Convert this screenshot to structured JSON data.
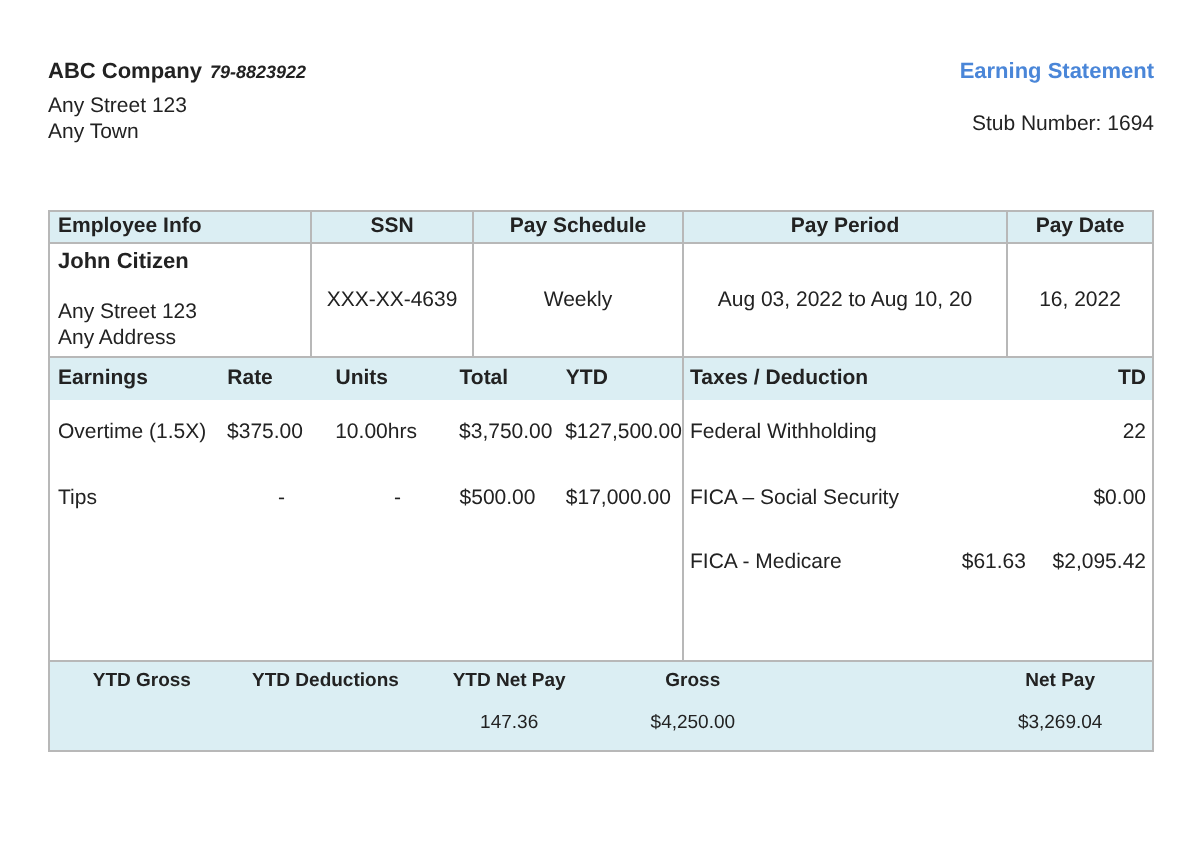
{
  "company": {
    "name": "ABC Company",
    "ein": "79-8823922",
    "address": [
      "Any Street 123",
      "Any Town"
    ]
  },
  "title": "Earning Statement",
  "stub_number": "Stub Number: 1694",
  "info_columns": [
    "Employee Info",
    "SSN",
    "Pay Schedule",
    "Pay Period",
    "Pay Date"
  ],
  "employee": {
    "name": "John Citizen",
    "address": [
      "Any Street 123",
      "Any Address"
    ]
  },
  "info_values": [
    "XXX-XX-4639",
    "Weekly",
    "Aug 03, 2022 to Aug 10, 20",
    "16, 2022"
  ],
  "earnings": {
    "columns": [
      "Earnings",
      "Rate",
      "Units",
      "Total",
      "YTD"
    ],
    "rows": [
      [
        "Overtime (1.5X)",
        "$375.00",
        "10.00hrs",
        "$3,750.00",
        "$127,500.00"
      ],
      [
        "Tips",
        "-",
        "-",
        "$500.00",
        "$17,000.00"
      ]
    ]
  },
  "taxes": {
    "columns": [
      "Taxes / Deduction"
    ],
    "column_3": "TD",
    "rows": [
      {
        "name": "Federal Withholding",
        "ytd": "22"
      },
      {
        "name": "FICA – Social Security",
        "ytd": "$0.00"
      },
      {
        "name": "FICA - Medicare",
        "current": "$61.63",
        "ytd": "$2,095.42"
      }
    ]
  },
  "summary": [
    {
      "label": "YTD Gross"
    },
    {
      "label": "YTD Deductions"
    },
    {
      "label": "YTD Net Pay",
      "value": "147.36"
    },
    {
      "label": "Gross",
      "value": "$4,250.00"
    },
    {
      "label": "Net Pay",
      "value": "$3,269.04"
    }
  ]
}
